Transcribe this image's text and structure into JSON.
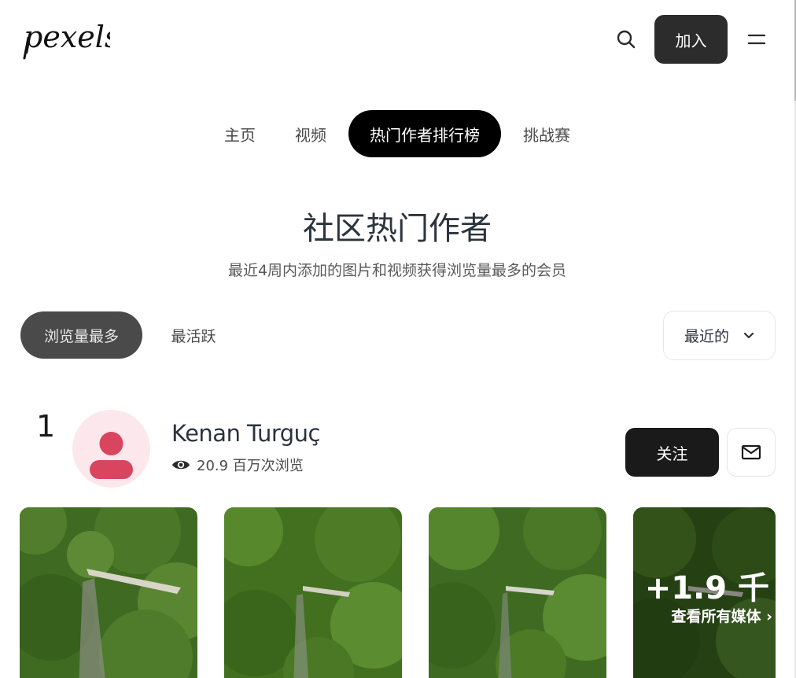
{
  "header": {
    "logo_text": "pexels",
    "join_label": "加入",
    "icons": {
      "search": "search-icon",
      "menu": "menu-icon"
    }
  },
  "nav": {
    "tabs": [
      {
        "label": "主页",
        "active": false
      },
      {
        "label": "视频",
        "active": false
      },
      {
        "label": "热门作者排行榜",
        "active": true
      },
      {
        "label": "挑战赛",
        "active": false
      }
    ]
  },
  "page": {
    "title": "社区热门作者",
    "subtitle": "最近4周内添加的图片和视频获得浏览量最多的会员"
  },
  "filters": {
    "most_viewed": "浏览量最多",
    "most_active": "最活跃",
    "sort_label": "最近的"
  },
  "leaderboard": [
    {
      "rank": "1",
      "name": "Kenan Turguç",
      "views": "20.9 百万次浏览",
      "follow_label": "关注",
      "more_count": "+1.9 千",
      "more_label": "查看所有媒体 ›"
    }
  ],
  "colors": {
    "primary_dark": "#1a1a1a",
    "nav_active": "#000000",
    "filter_active": "#4a4a4a",
    "avatar_bg": "#fce8ec",
    "avatar_fg": "#d9455f"
  }
}
